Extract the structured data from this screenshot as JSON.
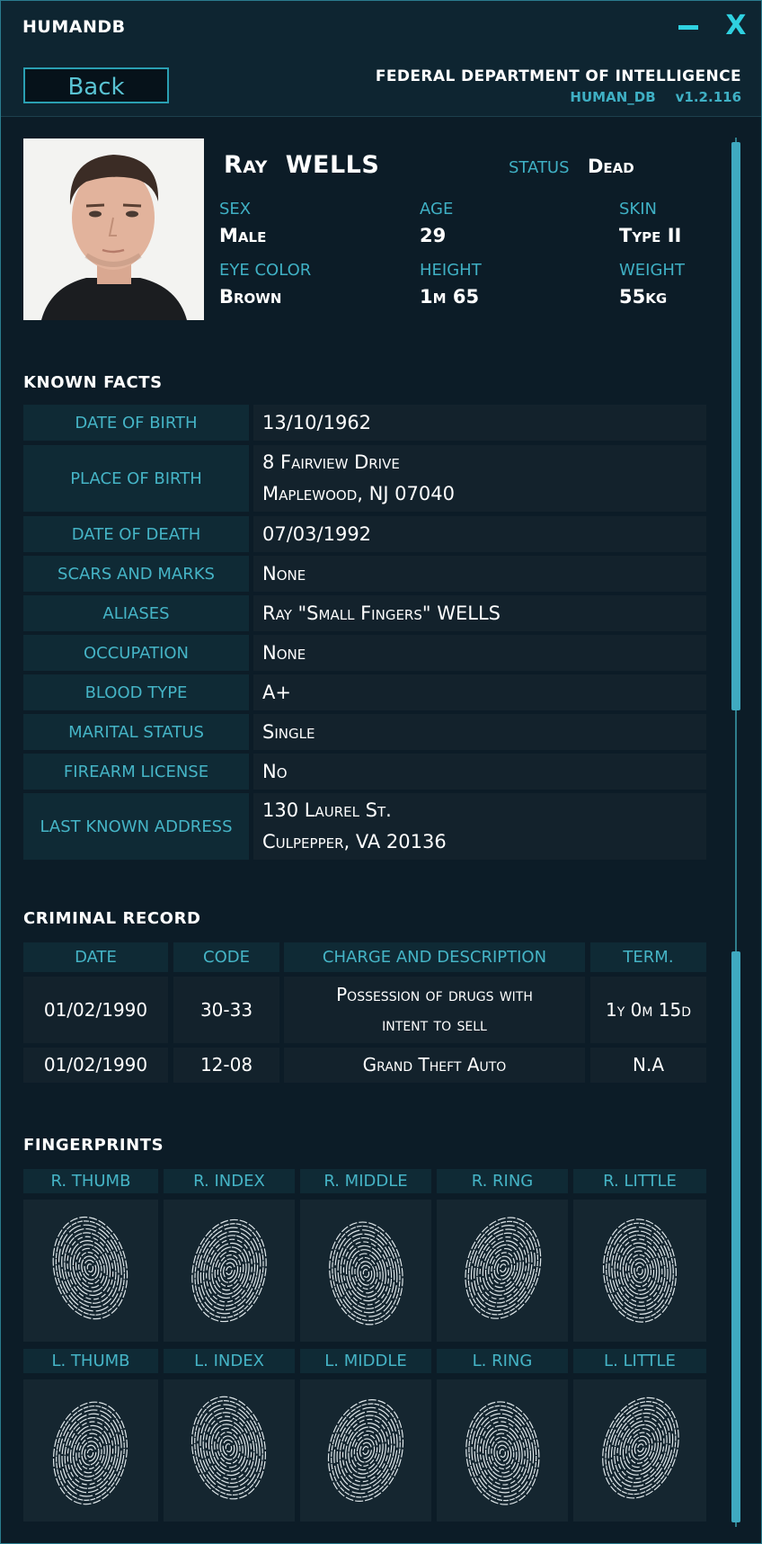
{
  "window": {
    "title": "HUMANDB",
    "minimize_glyph": "",
    "close_glyph": "X"
  },
  "header": {
    "back_label": "Back",
    "department": "FEDERAL DEPARTMENT OF INTELLIGENCE",
    "db_name": "HUMAN_DB",
    "version": "v1.2.116"
  },
  "profile": {
    "first_name": "Ray",
    "last_name": "WELLS",
    "status_label": "STATUS",
    "status": "Dead",
    "attributes": [
      {
        "label": "SEX",
        "value": "Male"
      },
      {
        "label": "AGE",
        "value": "29"
      },
      {
        "label": "SKIN",
        "value": "Type II"
      },
      {
        "label": "EYE COLOR",
        "value": "Brown"
      },
      {
        "label": "HEIGHT",
        "value": "1m 65"
      },
      {
        "label": "WEIGHT",
        "value": "55kg"
      }
    ]
  },
  "known_facts": {
    "title": "KNOWN  FACTS",
    "rows": [
      {
        "label": "DATE OF BIRTH",
        "lines": [
          "13/10/1962"
        ]
      },
      {
        "label": "PLACE OF BIRTH",
        "lines": [
          "8 Fairview Drive",
          "Maplewood, NJ 07040"
        ]
      },
      {
        "label": "DATE OF DEATH",
        "lines": [
          "07/03/1992"
        ]
      },
      {
        "label": "SCARS AND MARKS",
        "lines": [
          "None"
        ]
      },
      {
        "label": "ALIASES",
        "lines": [
          "Ray \"Small Fingers\" WELLS"
        ]
      },
      {
        "label": "OCCUPATION",
        "lines": [
          "None"
        ]
      },
      {
        "label": "BLOOD TYPE",
        "lines": [
          "A+"
        ]
      },
      {
        "label": "MARITAL STATUS",
        "lines": [
          "Single"
        ]
      },
      {
        "label": "FIREARM LICENSE",
        "lines": [
          "No"
        ]
      },
      {
        "label": "LAST KNOWN ADDRESS",
        "lines": [
          "130 Laurel St.",
          "Culpepper, VA 20136"
        ]
      }
    ]
  },
  "criminal_record": {
    "title": "CRIMINAL  RECORD",
    "columns": [
      "DATE",
      "CODE",
      "CHARGE AND DESCRIPTION",
      "TERM."
    ],
    "rows": [
      {
        "date": "01/02/1990",
        "code": "30-33",
        "charge_lines": [
          "Possession of drugs with",
          "intent to sell"
        ],
        "term": "1y 0m 15d"
      },
      {
        "date": "01/02/1990",
        "code": "12-08",
        "charge_lines": [
          "Grand Theft Auto"
        ],
        "term": "N.A"
      }
    ]
  },
  "fingerprints": {
    "title": "FINGERPRINTS",
    "right": [
      "R. THUMB",
      "R. INDEX",
      "R. MIDDLE",
      "R. RING",
      "R. LITTLE"
    ],
    "left": [
      "L. THUMB",
      "L. INDEX",
      "L. MIDDLE",
      "L. RING",
      "L. LITTLE"
    ]
  },
  "colors": {
    "accent": "#3fb0c4",
    "background": "#0c1c27",
    "label_cell": "#0f2a35",
    "value_cell": "#13222c"
  }
}
